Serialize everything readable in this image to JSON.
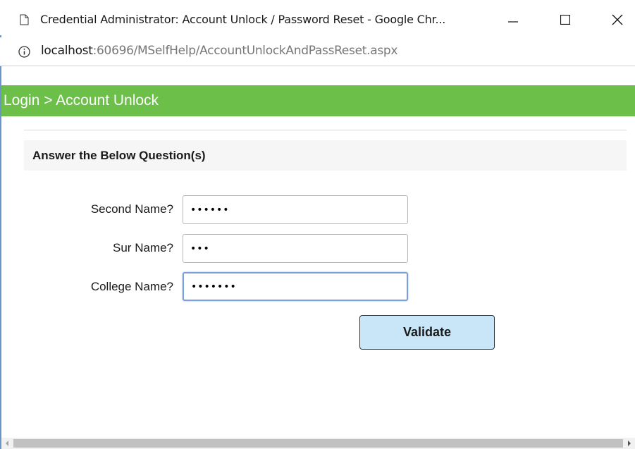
{
  "window": {
    "title": "Credential Administrator: Account Unlock / Password Reset - Google Chr...",
    "minimize_icon": "minimize-icon",
    "maximize_icon": "maximize-icon",
    "close_icon": "close-icon"
  },
  "address": {
    "host": "localhost",
    "rest": ":60696/MSelfHelp/AccountUnlockAndPassReset.aspx",
    "info_icon": "info-icon"
  },
  "banner": {
    "text": "Login > Account Unlock",
    "color": "#6cc04a"
  },
  "section": {
    "heading": "Answer the Below Question(s)"
  },
  "questions": [
    {
      "label": "Second Name?",
      "value": "xxxxxx"
    },
    {
      "label": "Sur Name?",
      "value": "xxx"
    },
    {
      "label": "College Name?",
      "value": "xxxxxxx"
    }
  ],
  "actions": {
    "validate_label": "Validate",
    "validate_color": "#c8e6f8"
  }
}
